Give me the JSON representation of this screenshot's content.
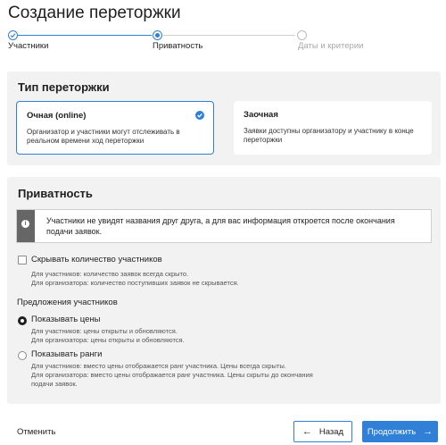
{
  "page": {
    "title": "Создание переторжки"
  },
  "stepper": {
    "steps": [
      {
        "label": "Участники",
        "state": "done"
      },
      {
        "label": "Приватность",
        "state": "active"
      },
      {
        "label": "Даты и критерии",
        "state": "pending"
      }
    ]
  },
  "auction_type": {
    "title": "Тип переторжки",
    "options": [
      {
        "title": "Очная (online)",
        "description": "Организатор и участники могут отслеживать в реальном времени ход переторжки",
        "selected": true
      },
      {
        "title": "Заочная",
        "description": "Заявки доступны организатору и участнику в конце переторжки",
        "selected": false
      }
    ]
  },
  "privacy": {
    "title": "Приватность",
    "info": "Участники не увидят названия друг друга, а для вас информация откроется после окончания подачи заявок.",
    "hide_count": {
      "label": "Скрывать количество участников",
      "checked": false,
      "help_participants": "Для участников: количество заявок всегда скрыто.",
      "help_organizer": "Для организатора: количество поступивших заявок не скрывается."
    },
    "offers_group_label": "Предложения участников",
    "offers": [
      {
        "label": "Показывать цены",
        "selected": true,
        "help_participants": "Для участников: цены открыты и обновляются.",
        "help_organizer": "Для организатора: цены открыты и обновляются."
      },
      {
        "label": "Показывать ранги",
        "selected": false,
        "help_participants": "Для участников: вместо цены отображается ранг участника. Цены всегда скрыты.",
        "help_organizer": "Для организатора: вместо цены отображается ранг участника. Цены скрыты до окончания подачи заявок."
      }
    ]
  },
  "footer": {
    "cancel_label": "Отменить",
    "back_label": "Назад",
    "next_label": "Продолжить"
  },
  "colors": {
    "accent": "#2f80d6",
    "panel": "#f2f2f2",
    "info_strip": "#666666"
  },
  "icons": {
    "step_done": "check-circle-icon",
    "step_active": "dot-circle-icon",
    "selected_card": "check-badge-icon",
    "info": "info-icon",
    "back": "arrow-left-icon",
    "next": "arrow-right-icon"
  }
}
